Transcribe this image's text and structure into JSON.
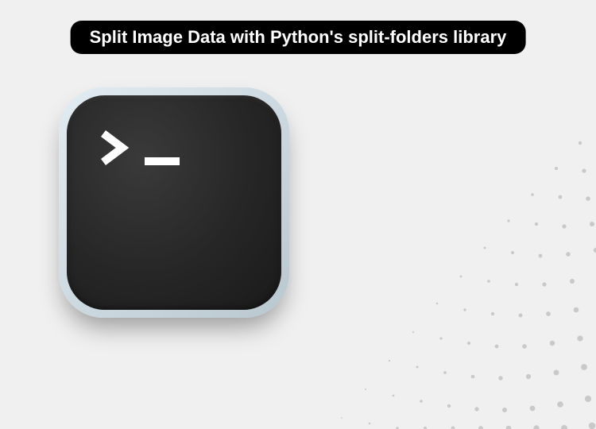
{
  "title": "Split Image Data with Python's split-folders library",
  "icon": {
    "name": "terminal",
    "prompt_glyph": "> _"
  },
  "colors": {
    "background": "#f0f0f0",
    "pill_bg": "#000000",
    "pill_text": "#ffffff",
    "terminal_bg": "#262626",
    "terminal_glyph": "#ffffff",
    "dots": "#c9c9c9"
  }
}
